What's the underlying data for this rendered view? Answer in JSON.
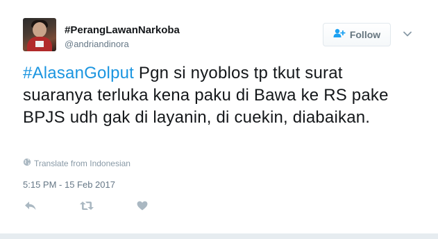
{
  "tweet": {
    "display_name": "#PerangLawanNarkoba",
    "handle": "@andriandinora",
    "follow_label": "Follow",
    "text_hashtag": "#AlasanGolput",
    "text_body": " Pgn si nyoblos tp tkut surat suaranya terluka kena paku di Bawa ke RS pake BPJS udh gak di layanin, di cuekin, diabaikan.",
    "translate_label": "Translate from Indonesian",
    "timestamp": "5:15 PM - 15 Feb 2017"
  },
  "icons": {
    "follow": "add-user-icon",
    "menu": "chevron-down-icon",
    "translate": "globe-icon",
    "reply": "reply-icon",
    "retweet": "retweet-icon",
    "like": "heart-icon"
  },
  "colors": {
    "hashtag": "#1b95e0",
    "text": "#14171a",
    "secondary": "#657786",
    "icon": "#aab8c2",
    "follow_text": "#66757f"
  }
}
